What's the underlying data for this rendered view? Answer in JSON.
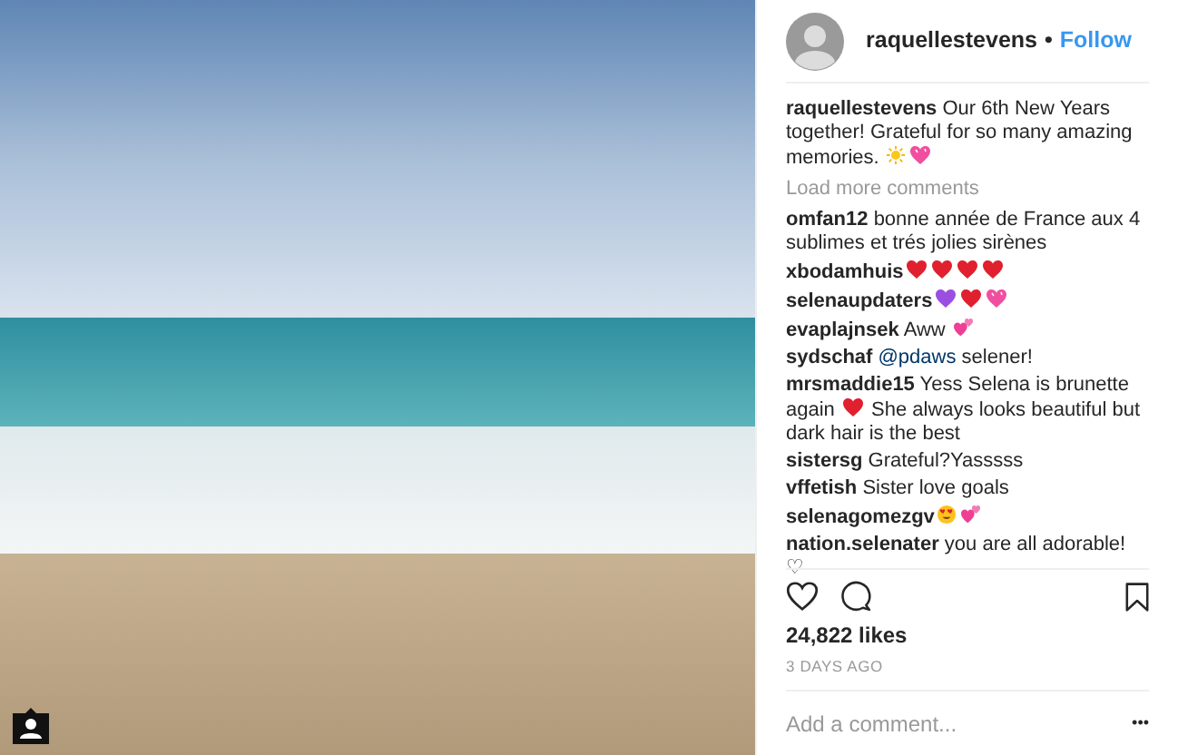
{
  "photo": {
    "tagged_users": true
  },
  "header": {
    "username": "raquellestevens",
    "separator": "•",
    "follow": "Follow"
  },
  "caption": {
    "username": "raquellestevens",
    "parts": [
      {
        "kind": "text",
        "text": "Our 6th New Years together! Grateful for so many amazing memories."
      },
      {
        "kind": "sun"
      },
      {
        "kind": "sparkling-heart"
      }
    ]
  },
  "load_more": "Load more comments",
  "comments": [
    {
      "username": "omfan12",
      "parts": [
        {
          "kind": "text",
          "text": "bonne année de France aux 4 sublimes et trés jolies sirènes"
        }
      ]
    },
    {
      "username": "xbodamhuis",
      "parts": [
        {
          "kind": "heart",
          "color": "#e0202e"
        },
        {
          "kind": "heart",
          "color": "#e0202e"
        },
        {
          "kind": "heart",
          "color": "#e0202e"
        },
        {
          "kind": "heart",
          "color": "#e0202e"
        }
      ]
    },
    {
      "username": "selenaupdaters",
      "parts": [
        {
          "kind": "heart",
          "color": "#9b4fe0"
        },
        {
          "kind": "heart",
          "color": "#e0202e"
        },
        {
          "kind": "sparkling-heart"
        }
      ]
    },
    {
      "username": "evaplajnsek",
      "parts": [
        {
          "kind": "text",
          "text": "Aww"
        },
        {
          "kind": "two-hearts"
        }
      ]
    },
    {
      "username": "sydschaf",
      "parts": [
        {
          "kind": "mention",
          "text": "@pdaws"
        },
        {
          "kind": "text",
          "text": "selener!"
        }
      ]
    },
    {
      "username": "mrsmaddie15",
      "parts": [
        {
          "kind": "text",
          "text": "Yess Selena is brunette again"
        },
        {
          "kind": "heart",
          "color": "#e0202e"
        },
        {
          "kind": "text",
          "text": "She always looks beautiful but dark hair is the best"
        }
      ]
    },
    {
      "username": "sistersg",
      "parts": [
        {
          "kind": "text",
          "text": "Grateful?Yasssss"
        }
      ]
    },
    {
      "username": "vffetish",
      "parts": [
        {
          "kind": "text",
          "text": "Sister love goals"
        }
      ]
    },
    {
      "username": "selenagomezgv",
      "parts": [
        {
          "kind": "heart-eyes-face"
        },
        {
          "kind": "two-hearts"
        }
      ]
    },
    {
      "username": "nation.selenater",
      "parts": [
        {
          "kind": "text",
          "text": "you are all adorable! ♡"
        }
      ]
    }
  ],
  "actions": {
    "liked": false,
    "saved": false
  },
  "likes": "24,822 likes",
  "time": "3 DAYS AGO",
  "comment_field": {
    "placeholder": "Add a comment..."
  },
  "more": "•••"
}
